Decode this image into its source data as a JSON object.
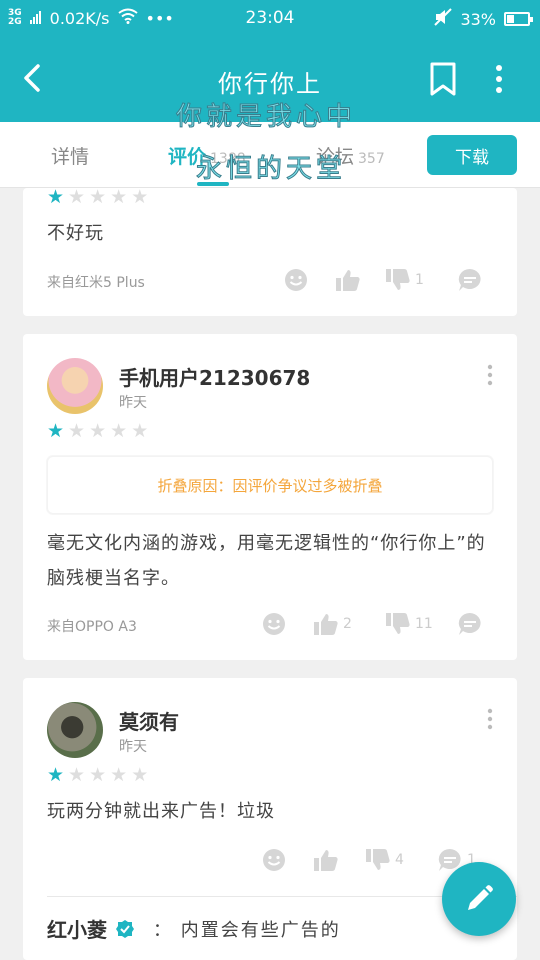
{
  "status_bar": {
    "network_top": "3G",
    "network_bottom": "2G",
    "speed": "0.02K/s",
    "dots": "•••",
    "time": "23:04",
    "battery": "33%"
  },
  "app_bar": {
    "title": "你行你上"
  },
  "overlay_text": {
    "line1": "你就是我心中",
    "line2": "永恒的天堂"
  },
  "tabs": [
    {
      "label": "详情",
      "count": ""
    },
    {
      "label": "评价",
      "count": "1388"
    },
    {
      "label": "论坛",
      "count": "357"
    }
  ],
  "download_label": "下载",
  "reviews": [
    {
      "rating": 1,
      "content": "不好玩",
      "device": "来自红米5 Plus",
      "likes": "",
      "dislikes": "1"
    },
    {
      "username": "手机用户21230678",
      "date": "昨天",
      "rating": 1,
      "fold_notice": "折叠原因：因评价争议过多被折叠",
      "content": "毫无文化内涵的游戏，用毫无逻辑性的“你行你上”的脑残梗当名字。",
      "device": "来自OPPO A3",
      "likes": "2",
      "dislikes": "11"
    },
    {
      "username": "莫须有",
      "date": "昨天",
      "rating": 1,
      "content": "玩两分钟就出来广告！垃圾",
      "likes": "",
      "dislikes": "4",
      "comments": "1",
      "reply_user": "红小菱",
      "reply_text": "：  内置会有些广告的"
    }
  ],
  "colors": {
    "accent": "#1fb5c2",
    "fold_text": "#f4a63c"
  }
}
